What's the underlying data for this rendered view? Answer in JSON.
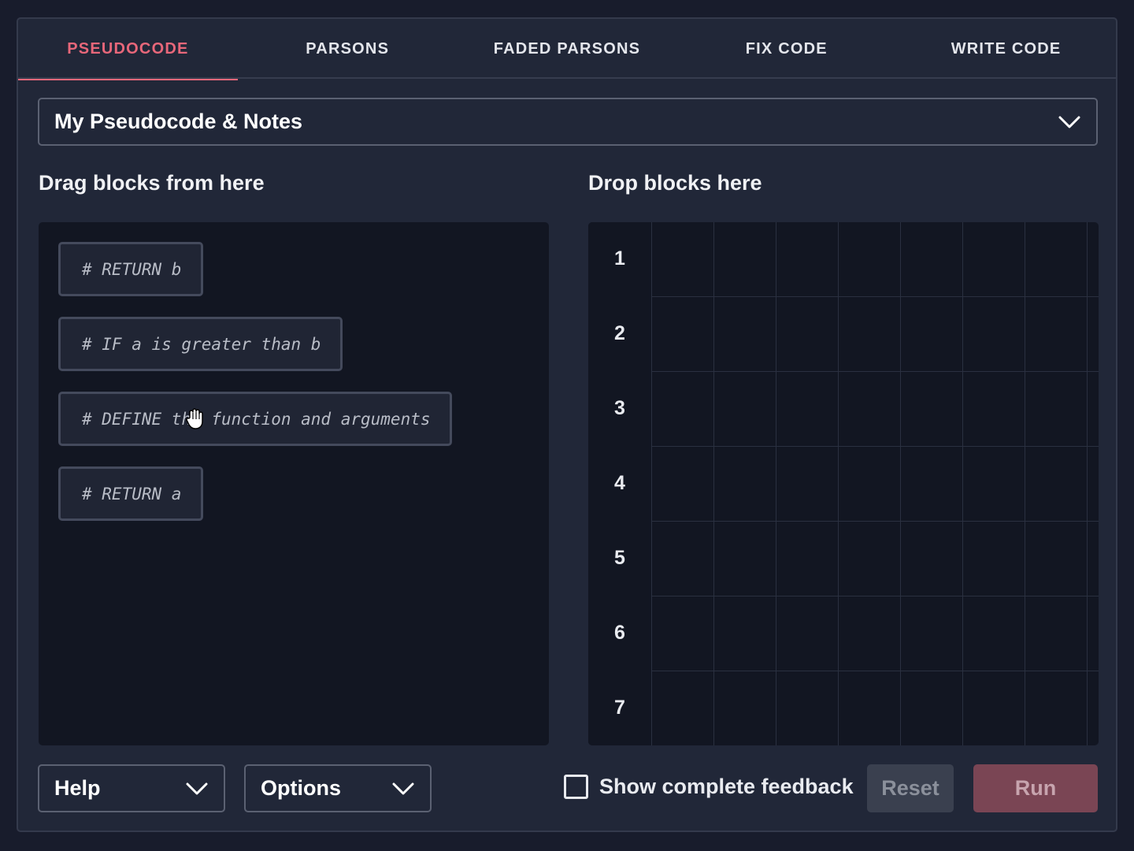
{
  "tabs": [
    {
      "label": "PSEUDOCODE",
      "active": true
    },
    {
      "label": "PARSONS",
      "active": false
    },
    {
      "label": "FADED PARSONS",
      "active": false
    },
    {
      "label": "FIX CODE",
      "active": false
    },
    {
      "label": "WRITE CODE",
      "active": false
    }
  ],
  "notes_select": {
    "label": "My Pseudocode & Notes",
    "icon": "chevron-down-icon"
  },
  "source_area": {
    "heading": "Drag blocks from here",
    "blocks": [
      "# RETURN b",
      "# IF a is greater than b",
      "# DEFINE the function and arguments",
      "# RETURN a"
    ]
  },
  "target_area": {
    "heading": "Drop blocks here",
    "line_numbers": [
      "1",
      "2",
      "3",
      "4",
      "5",
      "6",
      "7"
    ]
  },
  "footer": {
    "help_label": "Help",
    "options_label": "Options",
    "feedback_label": "Show complete feedback",
    "feedback_checked": false,
    "reset_label": "Reset",
    "run_label": "Run"
  },
  "colors": {
    "background": "#181c2c",
    "panel": "#212738",
    "accent": "#e8677a",
    "run_button": "#7a4554",
    "reset_button": "#3a404f"
  },
  "cursor_icon": "grab-hand-icon"
}
